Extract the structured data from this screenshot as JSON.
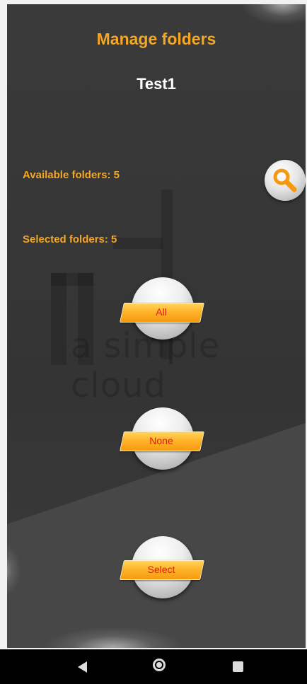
{
  "header": {
    "title": "Manage folders",
    "account": "Test1"
  },
  "info": {
    "available": "Available folders: 5",
    "selected": "Selected folders: 5"
  },
  "watermark": {
    "text": "a simple cloud"
  },
  "buttons": {
    "all": "All",
    "none": "None",
    "select": "Select"
  },
  "colors": {
    "accent": "#f5a623",
    "button_text": "#e01818",
    "background": "#363636"
  },
  "icons": {
    "search": "magnifier-icon",
    "nav_back": "back-triangle-icon",
    "nav_home": "home-circle-icon",
    "nav_recent": "recents-square-icon"
  }
}
